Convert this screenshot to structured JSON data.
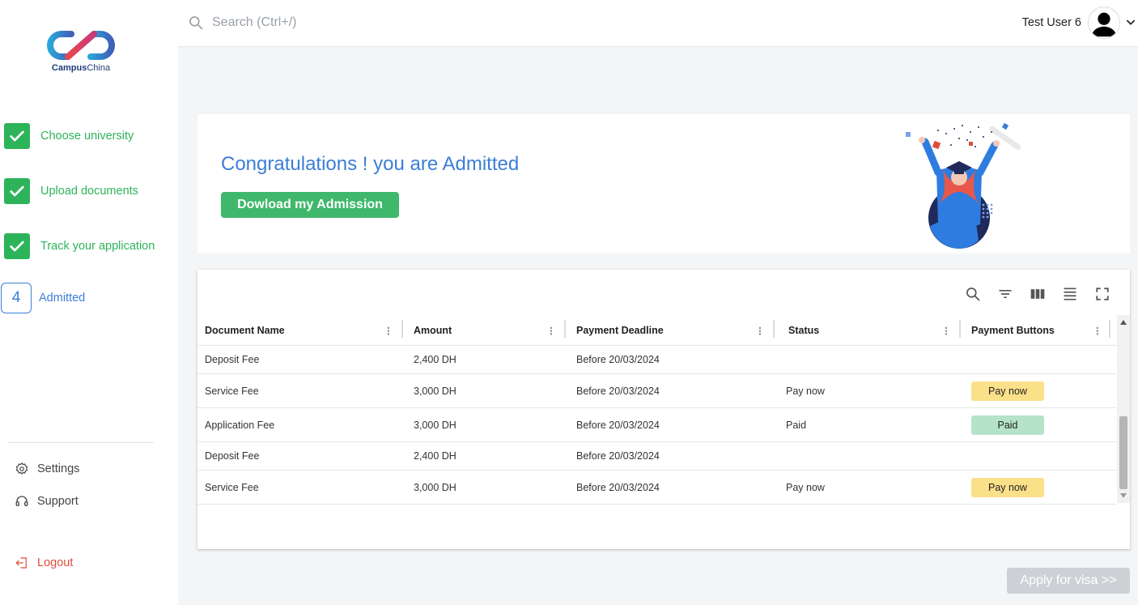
{
  "brand": {
    "name_bold": "Campus",
    "name_rest": "China"
  },
  "steps": [
    {
      "label": "Choose university",
      "state": "done"
    },
    {
      "label": "Upload documents",
      "state": "done"
    },
    {
      "label": "Track your application",
      "state": "done"
    },
    {
      "number": "4",
      "label": "Admitted",
      "state": "active"
    }
  ],
  "sidebar_links": {
    "settings": "Settings",
    "support": "Support",
    "logout": "Logout"
  },
  "search": {
    "placeholder": "Search (Ctrl+/)"
  },
  "user": {
    "name": "Test User 6"
  },
  "banner": {
    "title": "Congratulations ! you are Admitted",
    "download_label": "Dowload my Admission"
  },
  "table": {
    "columns": [
      "Document Name",
      "Amount",
      "Payment Deadline",
      "Status",
      "Payment Buttons"
    ],
    "rows": [
      {
        "name": "Deposit Fee",
        "amount": "2,400 DH",
        "deadline": "Before 20/03/2024",
        "status": "",
        "button": ""
      },
      {
        "name": "Service Fee",
        "amount": "3,000 DH",
        "deadline": "Before 20/03/2024",
        "status": "Pay now",
        "button": "Pay now"
      },
      {
        "name": "Application Fee",
        "amount": "3,000 DH",
        "deadline": "Before 20/03/2024",
        "status": "Paid",
        "button": "Paid"
      },
      {
        "name": "Deposit Fee",
        "amount": "2,400 DH",
        "deadline": "Before 20/03/2024",
        "status": "",
        "button": ""
      },
      {
        "name": "Service Fee",
        "amount": "3,000 DH",
        "deadline": "Before 20/03/2024",
        "status": "Pay now",
        "button": "Pay now"
      }
    ]
  },
  "visa_button": "Apply for visa >>",
  "colors": {
    "success": "#2db45a",
    "primary": "#3b7ed6",
    "danger": "#e04b3a",
    "pay": "#fbe08a",
    "paid": "#b5e3c7"
  },
  "icons": [
    "check-icon",
    "search-icon",
    "settings-icon",
    "headset-icon",
    "logout-icon",
    "user-avatar-icon",
    "chevron-down-icon",
    "filter-icon",
    "columns-icon",
    "density-icon",
    "fullscreen-icon",
    "column-menu-icon"
  ]
}
